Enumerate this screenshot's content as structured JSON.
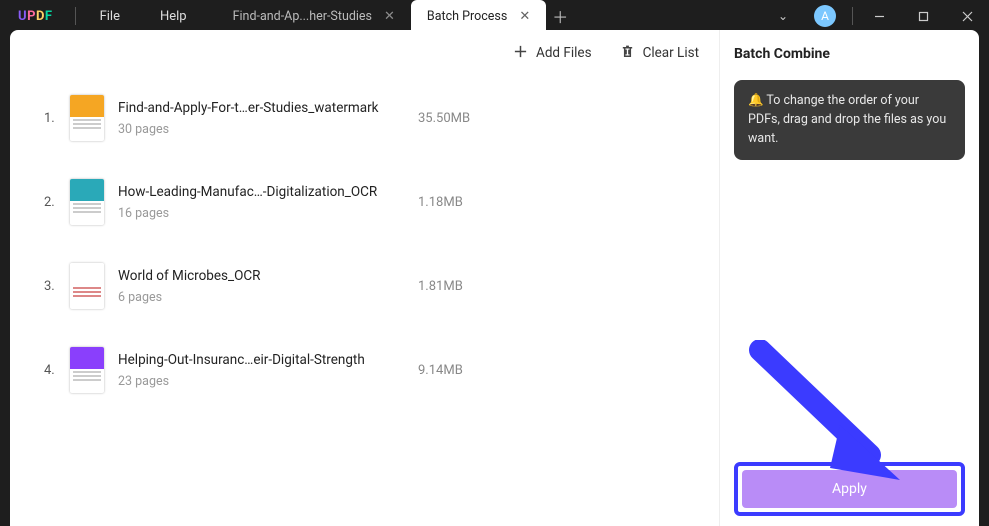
{
  "app": {
    "logo": "UPDF",
    "avatar_initial": "A"
  },
  "menu": {
    "file": "File",
    "help": "Help"
  },
  "tabs": {
    "inactive_label": "Find-and-Ap...her-Studies",
    "active_label": "Batch Process"
  },
  "toolbar": {
    "add_files": "Add Files",
    "clear_list": "Clear List"
  },
  "files": [
    {
      "num": "1.",
      "name": "Find-and-Apply-For-t…er-Studies_watermark",
      "pages": "30 pages",
      "size": "35.50MB",
      "thumb": "th-orange"
    },
    {
      "num": "2.",
      "name": "How-Leading-Manufac…-Digitalization_OCR",
      "pages": "16 pages",
      "size": "1.18MB",
      "thumb": "th-teal"
    },
    {
      "num": "3.",
      "name": "World of Microbes_OCR",
      "pages": "6 pages",
      "size": "1.81MB",
      "thumb": "th-white"
    },
    {
      "num": "4.",
      "name": "Helping-Out-Insuranc…eir-Digital-Strength",
      "pages": "23 pages",
      "size": "9.14MB",
      "thumb": "th-purple"
    }
  ],
  "side": {
    "title": "Batch Combine",
    "hint": "🔔 To change the order of your PDFs, drag and drop the files as you want.",
    "apply": "Apply"
  }
}
